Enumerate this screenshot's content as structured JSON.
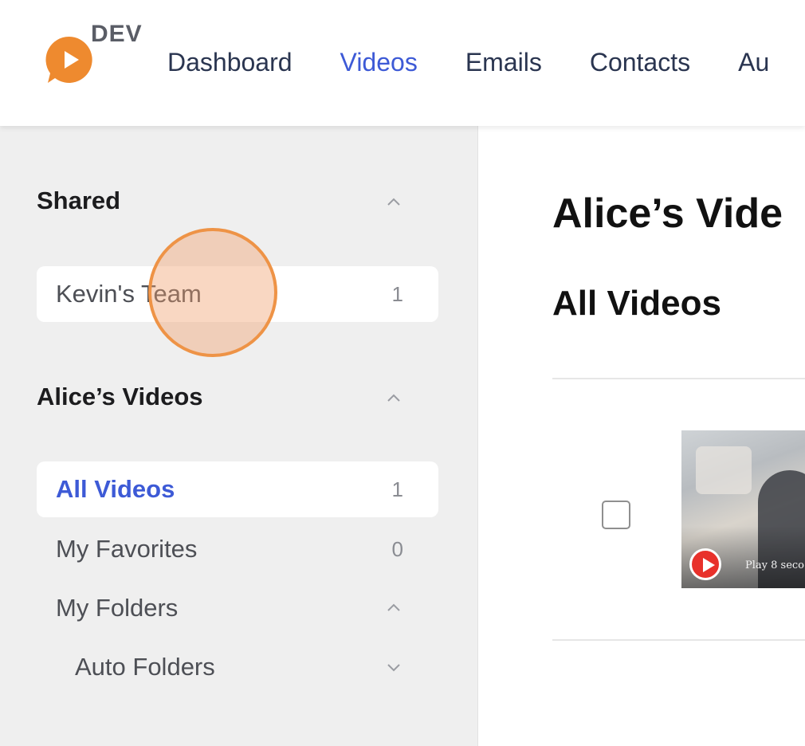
{
  "header": {
    "logo_badge": "DEV",
    "nav": [
      {
        "label": "Dashboard",
        "active": false
      },
      {
        "label": "Videos",
        "active": true
      },
      {
        "label": "Emails",
        "active": false
      },
      {
        "label": "Contacts",
        "active": false
      },
      {
        "label": "Au",
        "active": false
      }
    ]
  },
  "sidebar": {
    "shared": {
      "title": "Shared",
      "items": [
        {
          "label": "Kevin's Team",
          "count": "1"
        }
      ]
    },
    "alices_videos": {
      "title": "Alice’s Videos",
      "items": [
        {
          "label": "All Videos",
          "count": "1"
        },
        {
          "label": "My Favorites",
          "count": "0"
        },
        {
          "label": "My Folders"
        },
        {
          "label": "Auto Folders"
        }
      ]
    }
  },
  "main": {
    "title": "Alice’s Vide",
    "subtitle": "All Videos",
    "video": {
      "thumbnail_caption": "Play 8 seco"
    }
  },
  "colors": {
    "accent": "#3d5ad6",
    "logo_orange": "#ee8a2f",
    "play_red": "#e8312b",
    "click_indicator": "#ee9346"
  },
  "icons": {
    "logo": "play-bubble-icon",
    "collapse": "chevron-up-icon",
    "expand": "chevron-down-icon",
    "play": "play-icon"
  }
}
